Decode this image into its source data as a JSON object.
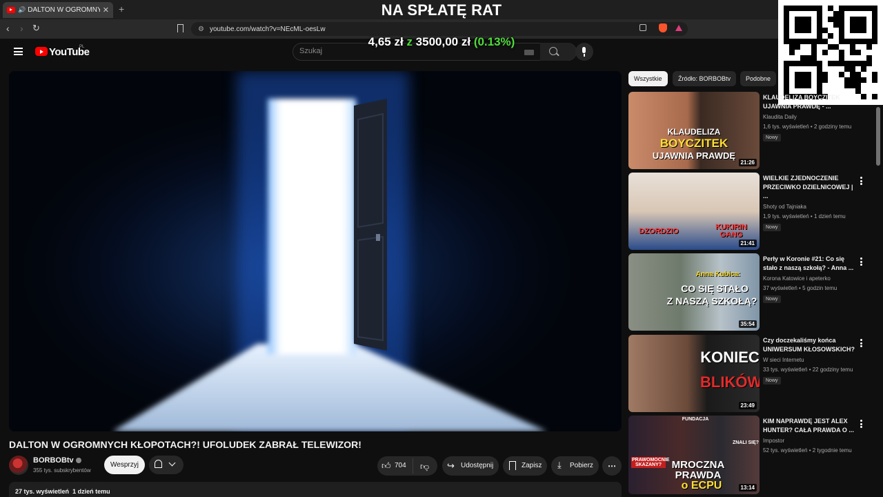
{
  "browser": {
    "tab_title": "DALTON W OGROMNYCH KŁ",
    "close_glyph": "✕",
    "new_tab_glyph": "+",
    "url": "youtube.com/watch?v=NEcML-oesLw"
  },
  "overlay": {
    "stream_title": "NA SPŁATĘ RAT",
    "donation_amount": "4,65 zł",
    "donation_sep": "z",
    "donation_goal": "3500,00 zł",
    "donation_pct": "(0.13%)"
  },
  "yt": {
    "wordmark": "YouTube",
    "region": "PL",
    "search_placeholder": "Szukaj"
  },
  "video": {
    "title": "DALTON W OGROMNYCH KŁOPOTACH?! UFOLUDEK ZABRAŁ TELEWIZOR!",
    "channel": "BORBOBtv",
    "subscribers": "355 tys. subskrybentów",
    "support_label": "Wesprzyj",
    "likes": "704",
    "share_label": "Udostępnij",
    "save_label": "Zapisz",
    "download_label": "Pobierz",
    "views": "27 tys. wyświetleń",
    "posted": "1 dzień temu"
  },
  "chips": [
    {
      "label": "Wszystkie",
      "active": true
    },
    {
      "label": "Źródło: BORBOBtv",
      "active": false
    },
    {
      "label": "Podobne",
      "active": false
    }
  ],
  "recommendations": [
    {
      "title": "KLAUDELIZA BOYCZITEK UJAWNIA PRAWDĘ - ...",
      "channel": "Klaudita Daily",
      "views": "1,6 tys. wyświetleń",
      "age": "2 godziny temu",
      "badge": "Nowy",
      "duration": "21:26",
      "thumb_lines": [
        "KLAUDELIZA",
        "BOYCZITEK",
        "UJAWNIA PRAWDĘ"
      ]
    },
    {
      "title": "WIELKIE ZJEDNOCZENIE PRZECIWKO DZIELNICOWEJ | ...",
      "channel": "Shoty od Tajniaka",
      "views": "1,9 tys. wyświetleń",
      "age": "1 dzień temu",
      "badge": "Nowy",
      "duration": "21:41",
      "thumb_lines": [
        "DZORDZIO",
        "KUKIRIN GANG"
      ]
    },
    {
      "title": "Perły w Koronie #21: Co się stało z naszą szkołą? - Anna ...",
      "channel": "Korona Katowice i apeterko",
      "views": "37 wyświetleń",
      "age": "5 godzin temu",
      "badge": "Nowy",
      "duration": "35:54",
      "thumb_lines": [
        "Anna Kubica:",
        "CO SIĘ STAŁO",
        "Z NASZĄ SZKOŁĄ?"
      ]
    },
    {
      "title": "Czy doczekaliśmy końca UNIWERSUM KŁOSOWSKICH?",
      "channel": "W sieci Internetu",
      "views": "33 tys. wyświetleń",
      "age": "22 godziny temu",
      "badge": "Nowy",
      "duration": "23:49",
      "thumb_lines": [
        "KONIEC",
        "BLIKÓW"
      ]
    },
    {
      "title": "KIM NAPRAWDĘ JEST ALEX HUNTER? CAŁA PRAWDA O ...",
      "channel": "Impostor",
      "views": "52 tys. wyświetleń",
      "age": "2 tygodnie temu",
      "badge": "",
      "duration": "13:14",
      "thumb_lines": [
        "FUNDACJA",
        "PRAWOMOCNIE SKAZANY?",
        "MROCZNA PRAWDA",
        "o ECPU",
        "ZNALI SIĘ?"
      ]
    }
  ],
  "colors": {
    "accent_red": "#ff0000",
    "donation_green": "#4fdc3a",
    "bg": "#0f0f0f"
  }
}
